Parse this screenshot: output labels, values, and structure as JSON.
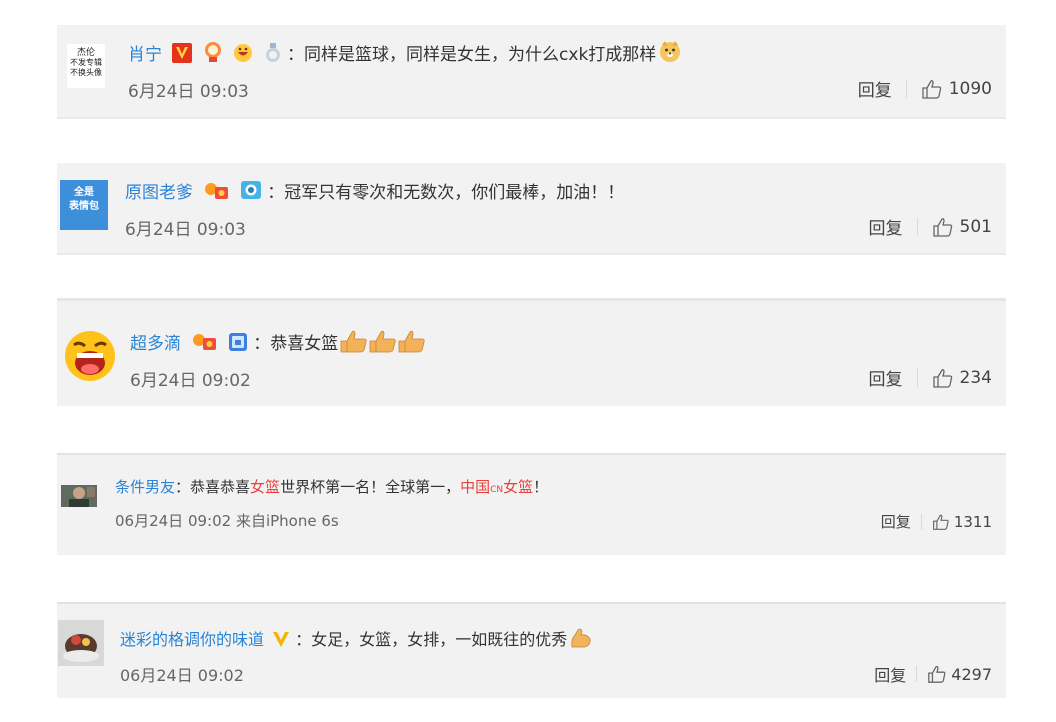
{
  "comments": [
    {
      "avatar": {
        "line1": "杰伦",
        "line2": "不发专辑",
        "line3": "不换头像"
      },
      "user": "肖宁",
      "text": "同样是篮球，同样是女生，为什么cxk打成那样",
      "time": "6月24日 09:03",
      "reply": "回复",
      "likes": "1090"
    },
    {
      "avatar": {
        "line1": "全是",
        "line2": "表情包"
      },
      "user": "原图老爹",
      "text": "冠军只有零次和无数次，你们最棒，加油！！",
      "time": "6月24日 09:03",
      "reply": "回复",
      "likes": "501"
    },
    {
      "user": "超多滴",
      "text": "恭喜女篮",
      "time": "6月24日 09:02",
      "reply": "回复",
      "likes": "234"
    },
    {
      "user": "条件男友",
      "text_a": "恭喜恭喜",
      "text_b": "女篮",
      "text_c": "世界杯第一名！全球第一，",
      "text_d": "中国",
      "text_e": "CN",
      "text_f": "女篮",
      "text_g": "！",
      "time": "06月24日 09:02 来自iPhone 6s",
      "reply": "回复",
      "likes": "1311"
    },
    {
      "user": "迷彩的格调你的味道",
      "text": "女足，女篮，女排，一如既往的优秀",
      "time": "06月24日 09:02",
      "reply": "回复",
      "likes": "4297"
    }
  ],
  "colon": "：",
  "icons": [
    "vip-v-icon",
    "medal-icon",
    "laugh-emoji-icon",
    "silver-medal-icon",
    "doge-emoji-icon",
    "fan-badge-icon",
    "camera-badge-icon",
    "calendar-badge-icon",
    "thumbs-up-emoji-icon",
    "muscle-emoji-icon",
    "like-icon"
  ],
  "colors": {
    "username": "#2a84d6",
    "card_bg": "#f2f2f2",
    "accent_red": "#e7413d"
  }
}
